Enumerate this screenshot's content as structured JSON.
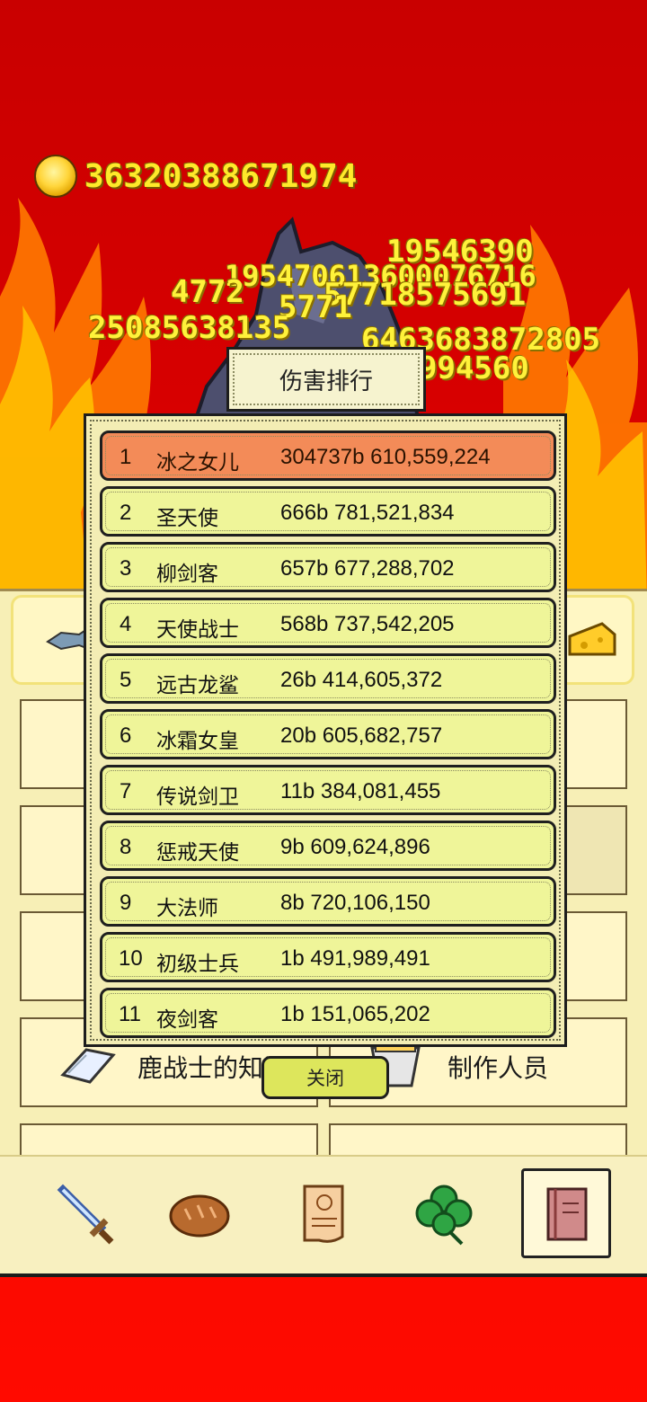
{
  "gold": {
    "amount": "36320388671974"
  },
  "damage_numbers": [
    "19546390",
    "195470613600076716",
    "4772",
    "57718575691",
    "5771",
    "25085638135",
    "6463683872805",
    "994560"
  ],
  "ranking": {
    "title": "伤害排行",
    "close_label": "关闭",
    "rows": [
      {
        "rank": "1",
        "name": "冰之女儿",
        "score": "304737b 610,559,224"
      },
      {
        "rank": "2",
        "name": "圣天使",
        "score": "666b 781,521,834"
      },
      {
        "rank": "3",
        "name": "柳剑客",
        "score": "657b 677,288,702"
      },
      {
        "rank": "4",
        "name": "天使战士",
        "score": "568b 737,542,205"
      },
      {
        "rank": "5",
        "name": "远古龙鲨",
        "score": "26b 414,605,372"
      },
      {
        "rank": "6",
        "name": "冰霜女皇",
        "score": "20b 605,682,757"
      },
      {
        "rank": "7",
        "name": "传说剑卫",
        "score": "11b 384,081,455"
      },
      {
        "rank": "8",
        "name": "惩戒天使",
        "score": "9b 609,624,896"
      },
      {
        "rank": "9",
        "name": "大法师",
        "score": "8b 720,106,150"
      },
      {
        "rank": "10",
        "name": "初级士兵",
        "score": "1b 491,989,491"
      },
      {
        "rank": "11",
        "name": "夜剑客",
        "score": "1b 151,065,202"
      }
    ]
  },
  "menu": {
    "knowledge_label": "鹿战士的知识",
    "credits_label": "制作人员"
  },
  "nav": {
    "items": [
      "sword-icon",
      "bread-icon",
      "scroll-icon",
      "clover-icon",
      "book-icon"
    ],
    "selected": "book-icon"
  }
}
